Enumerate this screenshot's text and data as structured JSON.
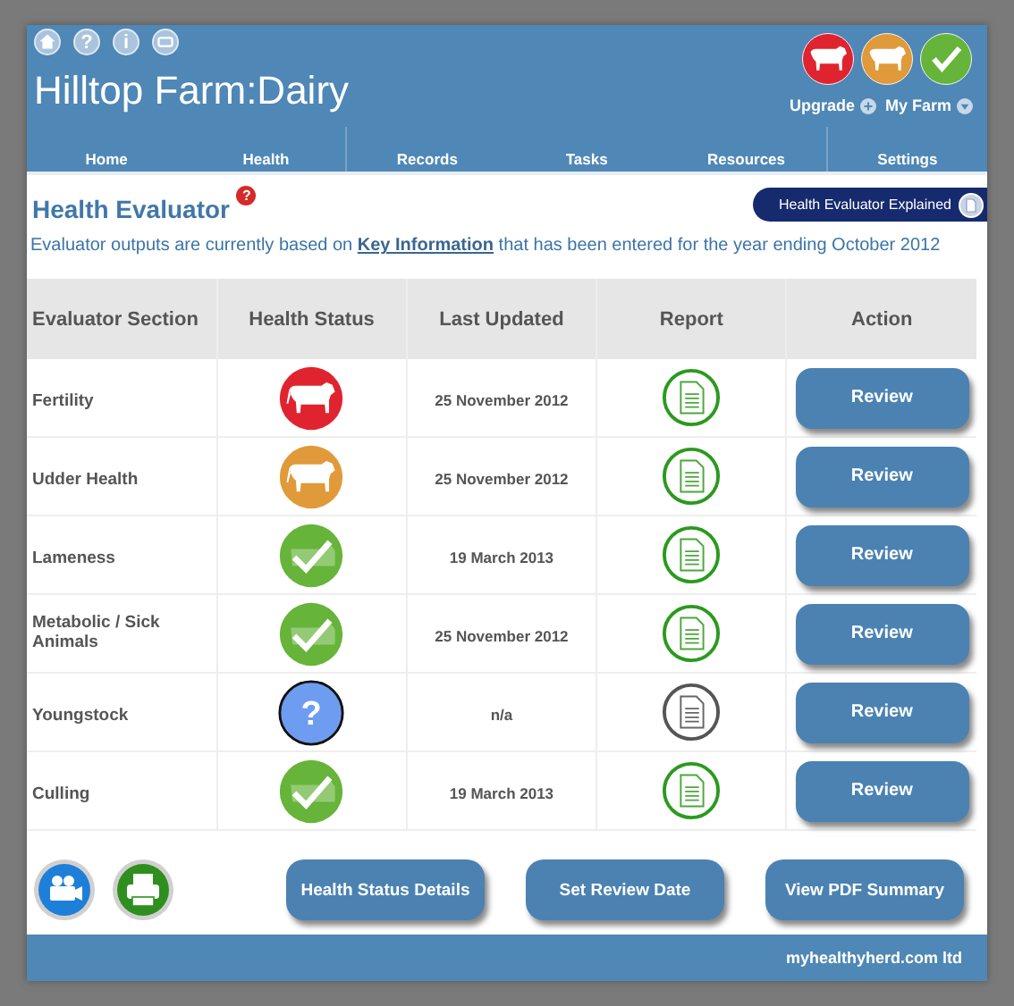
{
  "header": {
    "icons": [
      {
        "kind": "home"
      },
      {
        "kind": "glyph",
        "glyph": "?"
      },
      {
        "kind": "glyph",
        "glyph": "i"
      },
      {
        "kind": "mail"
      }
    ],
    "title": "Hilltop Farm:Dairy",
    "status_icons": [
      {
        "kind": "poor"
      },
      {
        "kind": "fair"
      },
      {
        "kind": "good"
      }
    ],
    "links": [
      {
        "label": "Upgrade",
        "kind": "plus"
      },
      {
        "label": "My Farm",
        "kind": "down"
      }
    ]
  },
  "nav": [
    {
      "label": "Home",
      "divider": false
    },
    {
      "label": "Health",
      "divider": true
    },
    {
      "label": "Records",
      "divider": false
    },
    {
      "label": "Tasks",
      "divider": false
    },
    {
      "label": "Resources",
      "divider": true
    },
    {
      "label": "Settings",
      "divider": false
    }
  ],
  "heading": {
    "title": "Health Evaluator",
    "help_badge": "?",
    "explained_button": "Health Evaluator Explained"
  },
  "intro": {
    "before": "Evaluator outputs are currently based on ",
    "link": "Key Information",
    "after": " that has been entered for the year ending October 2012"
  },
  "table": {
    "columns": [
      "Evaluator Section",
      "Health Status",
      "Last Updated",
      "Report",
      "Action"
    ],
    "rows": [
      {
        "section": "Fertility",
        "kind": "poor",
        "last_updated": "25 November 2012",
        "report_available": true,
        "action": "Review"
      },
      {
        "section": "Udder Health",
        "kind": "fair",
        "last_updated": "25 November 2012",
        "report_available": true,
        "action": "Review"
      },
      {
        "section": "Lameness",
        "kind": "good",
        "last_updated": "19 March 2013",
        "report_available": true,
        "action": "Review"
      },
      {
        "section": "Metabolic / Sick Animals",
        "kind": "good",
        "last_updated": "25 November 2012",
        "report_available": true,
        "action": "Review"
      },
      {
        "section": "Youngstock",
        "kind": "unknown",
        "status_glyph": "?",
        "last_updated": "n/a",
        "report_available": false,
        "action": "Review"
      },
      {
        "section": "Culling",
        "kind": "good",
        "last_updated": "19 March 2013",
        "report_available": true,
        "action": "Review"
      }
    ]
  },
  "bottom_buttons": [
    "Health Status Details",
    "Set Review Date",
    "View PDF Summary"
  ],
  "footer": "myhealthyherd.com ltd"
}
